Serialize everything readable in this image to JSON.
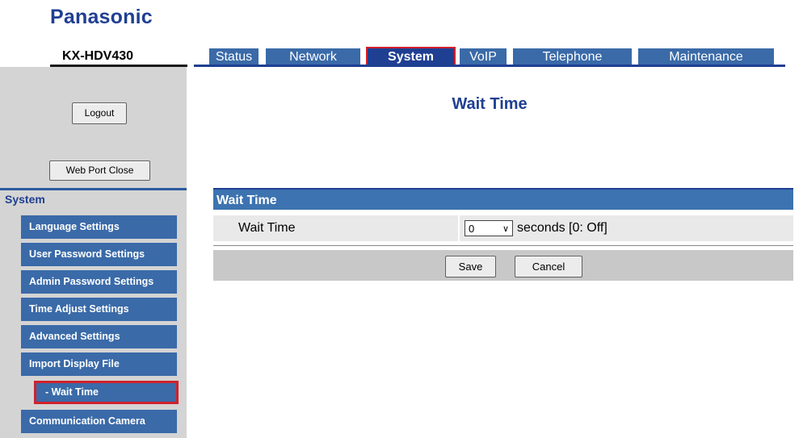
{
  "brand": {
    "logo": "Panasonic",
    "model": "KX-HDV430"
  },
  "tabs": [
    {
      "label": "Status",
      "active": false
    },
    {
      "label": "Network",
      "active": false
    },
    {
      "label": "System",
      "active": true
    },
    {
      "label": "VoIP",
      "active": false
    },
    {
      "label": "Telephone",
      "active": false
    },
    {
      "label": "Maintenance",
      "active": false
    }
  ],
  "sidebar": {
    "logout_label": "Logout",
    "webport_label": "Web Port Close",
    "heading": "System",
    "items": [
      {
        "label": "Language Settings"
      },
      {
        "label": "User Password Settings"
      },
      {
        "label": "Admin Password Settings"
      },
      {
        "label": "Time Adjust Settings"
      },
      {
        "label": "Advanced Settings"
      },
      {
        "label": "Import Display File"
      },
      {
        "label": "- Wait Time",
        "selected": true
      },
      {
        "label": "Communication Camera"
      }
    ]
  },
  "main": {
    "title": "Wait Time",
    "panel_heading": "Wait Time",
    "field_label": "Wait Time",
    "wait_value": "0",
    "unit_text": "seconds [0: Off]",
    "save_label": "Save",
    "cancel_label": "Cancel"
  },
  "colors": {
    "brand_blue": "#1f3f92",
    "tab_blue": "#3a6aa8",
    "highlight_red": "#d2202b"
  }
}
